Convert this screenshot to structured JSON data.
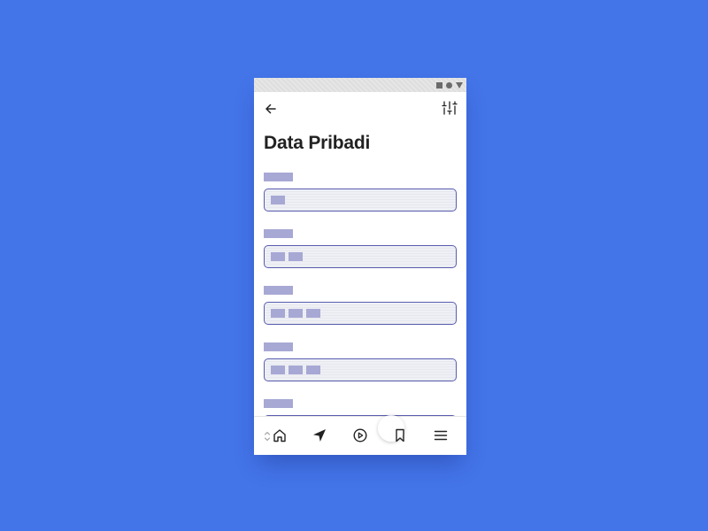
{
  "screen": {
    "title": "Data Pribadi"
  },
  "status_bar": {
    "icons": [
      "square-icon",
      "circle-icon",
      "triangle-icon"
    ]
  },
  "app_bar": {
    "left_icon": "arrow-left-icon",
    "right_icon": "sliders-icon"
  },
  "form": {
    "fields": [
      {
        "label": "",
        "value_blocks": 1
      },
      {
        "label": "",
        "value_blocks": 2
      },
      {
        "label": "",
        "value_blocks": 3
      },
      {
        "label": "",
        "value_blocks": 3
      },
      {
        "label": "",
        "value_blocks": 0
      }
    ]
  },
  "bottom_nav": {
    "items": [
      "home-icon",
      "navigation-icon",
      "play-icon",
      "bookmark-icon",
      "menu-icon"
    ]
  },
  "colors": {
    "background": "#4374e8",
    "placeholder": "#a7a8d4",
    "input_border": "#5a5dae",
    "input_fill": "#eef0f6",
    "title": "#222222"
  }
}
